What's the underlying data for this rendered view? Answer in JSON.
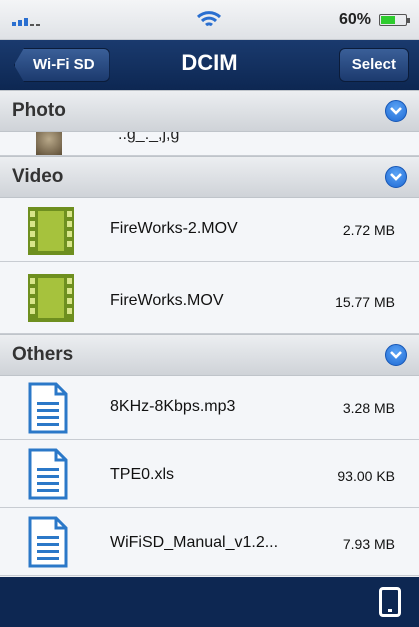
{
  "status": {
    "battery_text": "60%",
    "battery_level": 0.6
  },
  "nav": {
    "back_label": "Wi-Fi SD",
    "title": "DCIM",
    "select_label": "Select"
  },
  "sections": {
    "photo": {
      "title": "Photo",
      "peek_text": "..g_._,j,g"
    },
    "video": {
      "title": "Video",
      "items": [
        {
          "name": "FireWorks-2.MOV",
          "size": "2.72 MB",
          "icon": "film-icon"
        },
        {
          "name": "FireWorks.MOV",
          "size": "15.77 MB",
          "icon": "film-icon"
        }
      ]
    },
    "others": {
      "title": "Others",
      "items": [
        {
          "name": "8KHz-8Kbps.mp3",
          "size": "3.28 MB",
          "icon": "document-icon"
        },
        {
          "name": "TPE0.xls",
          "size": "93.00 KB",
          "icon": "document-icon"
        },
        {
          "name": "WiFiSD_Manual_v1.2...",
          "size": "7.93 MB",
          "icon": "document-icon"
        }
      ]
    }
  },
  "colors": {
    "nav": "#0d2752",
    "accent": "#1f6ad4",
    "film": "#7fa12a",
    "doc": "#2b78c8"
  }
}
